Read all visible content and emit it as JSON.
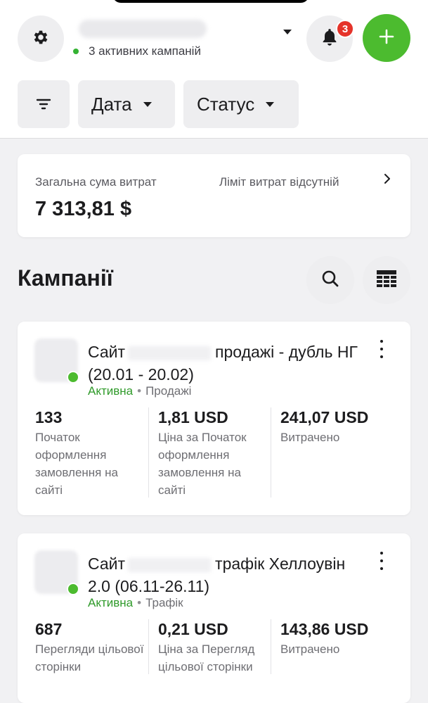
{
  "header": {
    "active_campaigns": "3 активних кампаній",
    "notifications_count": "3"
  },
  "filters": {
    "date_label": "Дата",
    "status_label": "Статус"
  },
  "summary": {
    "total_label": "Загальна сума витрат",
    "limit_label": "Ліміт витрат відсутній",
    "total_value": "7 313,81 $"
  },
  "campaigns_section": {
    "title": "Кампанії"
  },
  "campaigns": [
    {
      "title_prefix": "Сайт",
      "title_suffix": "продажі - дубль НГ (20.01 - 20.02)",
      "status": "Активна",
      "separator": "•",
      "category": "Продажі",
      "metrics": [
        {
          "value": "133",
          "label": "Початок оформлення замовлення на сайті"
        },
        {
          "value": "1,81 USD",
          "label": "Ціна за Початок оформлення замовлення на сайті"
        },
        {
          "value": "241,07 USD",
          "label": "Витрачено"
        }
      ]
    },
    {
      "title_prefix": "Сайт",
      "title_suffix": "трафік Хеллоувін 2.0 (06.11-26.11)",
      "status": "Активна",
      "separator": "•",
      "category": "Трафік",
      "metrics": [
        {
          "value": "687",
          "label": "Перегляди цільової сторінки"
        },
        {
          "value": "0,21 USD",
          "label": "Ціна за Перегляд цільової сторінки"
        },
        {
          "value": "143,86 USD",
          "label": "Витрачено"
        }
      ]
    }
  ],
  "icons": {
    "settings": "gear-icon",
    "notifications": "bell-icon",
    "add": "plus-icon",
    "filter": "filter-icon",
    "search": "search-icon",
    "columns": "table-columns-icon"
  },
  "colors": {
    "accent_green": "#4cbb2f",
    "status_green": "#2f9a2a",
    "badge_red": "#e5332a"
  }
}
